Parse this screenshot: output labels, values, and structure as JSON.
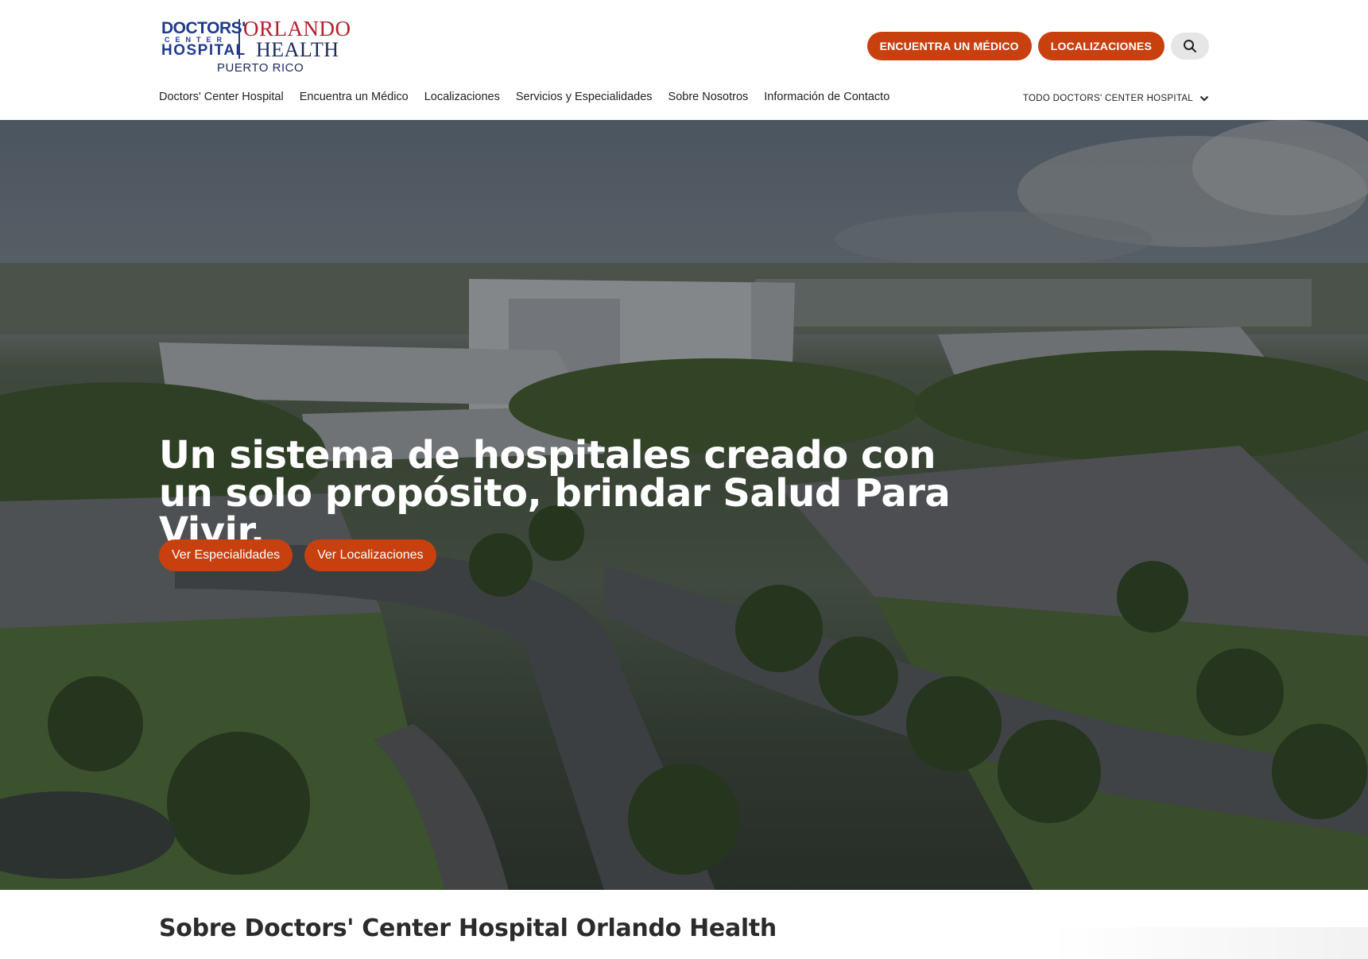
{
  "header": {
    "logo": {
      "line1": "DOCTORS'",
      "line2": "CENTER",
      "line3": "HOSPITAL",
      "brand1": "ORLANDO",
      "brand2": "HEALTH",
      "region": "PUERTO RICO"
    },
    "actions": {
      "find_doctor": "ENCUENTRA UN MÉDICO",
      "locations": "LOCALIZACIONES"
    },
    "nav": [
      {
        "label": "Doctors' Center Hospital"
      },
      {
        "label": "Encuentra un Médico"
      },
      {
        "label": "Localizaciones"
      },
      {
        "label": "Servicios y Especialidades"
      },
      {
        "label": "Sobre Nosotros"
      },
      {
        "label": "Información de Contacto"
      }
    ],
    "site_selector": "TODO DOCTORS' CENTER HOSPITAL"
  },
  "hero": {
    "headline": "Un sistema de hospitales creado con un solo propósito, brindar Salud Para Vivir.",
    "buttons": {
      "specialties": "Ver Especialidades",
      "locations": "Ver Localizaciones"
    }
  },
  "about": {
    "title": "Sobre Doctors' Center Hospital Orlando Health"
  },
  "colors": {
    "accent": "#c9400f",
    "navy": "#1f3a8c",
    "brand_red": "#b3202d"
  },
  "icons": {
    "search": "search-icon",
    "chevron": "chevron-down-icon"
  }
}
